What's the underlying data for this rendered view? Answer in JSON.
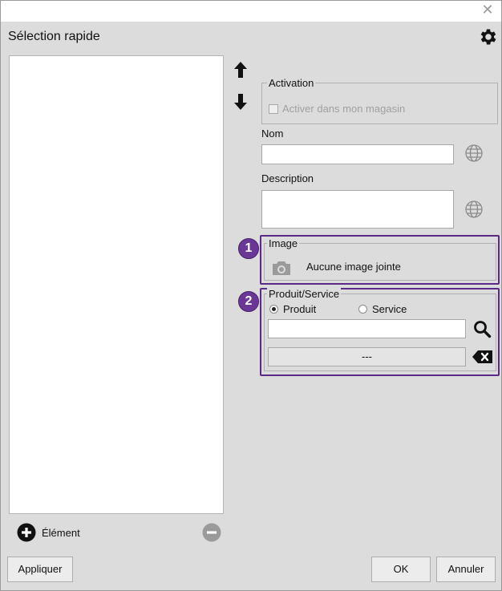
{
  "window": {
    "close_glyph": "✕",
    "title": "Sélection rapide"
  },
  "activation": {
    "legend": "Activation",
    "checkbox_label": "Activer dans mon magasin",
    "checked": false
  },
  "nom": {
    "label": "Nom",
    "value": ""
  },
  "description": {
    "label": "Description",
    "value": ""
  },
  "image": {
    "badge": "1",
    "legend": "Image",
    "status": "Aucune image jointe"
  },
  "produit_service": {
    "badge": "2",
    "legend": "Produit/Service",
    "options": [
      "Produit",
      "Service"
    ],
    "selected": "Produit",
    "search_value": "",
    "selection_display": "---"
  },
  "list": {
    "add_label": "Élément"
  },
  "footer": {
    "apply_label": "Appliquer",
    "ok_label": "OK",
    "cancel_label": "Annuler"
  },
  "icons": {
    "gear": "gear-icon",
    "up": "arrow-up-icon",
    "down": "arrow-down-icon",
    "globe": "globe-icon",
    "camera": "camera-icon",
    "search": "search-icon",
    "clear": "backspace-clear-icon",
    "add": "plus-circle-icon",
    "remove": "minus-circle-icon"
  },
  "colors": {
    "highlight": "#5b2a86",
    "badge": "#6a3796",
    "background": "#dcdcdc"
  }
}
